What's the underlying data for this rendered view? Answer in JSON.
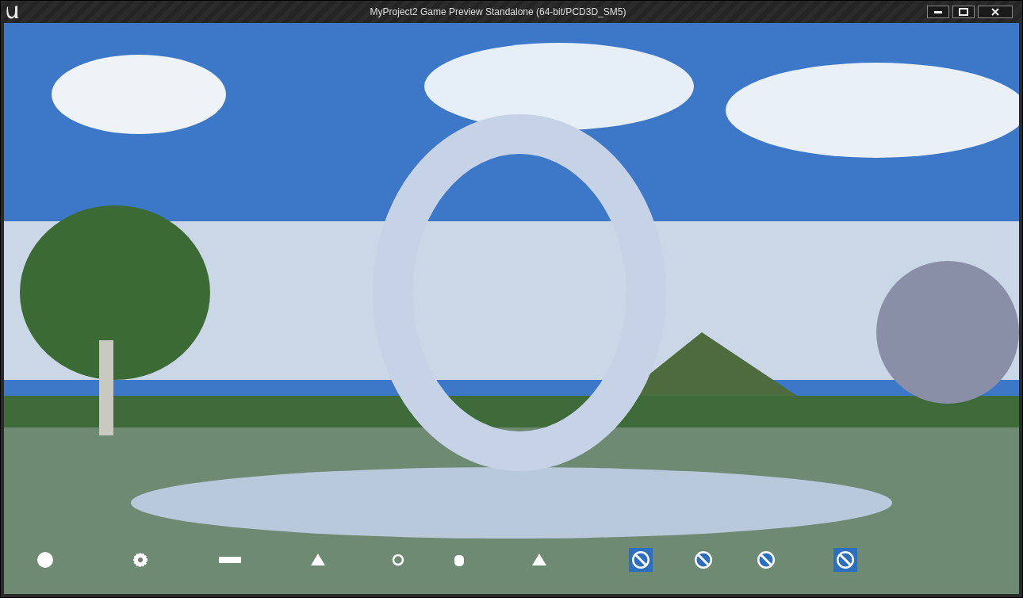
{
  "window": {
    "title": "MyProject2 Game Preview Standalone (64-bit/PCD3D_SM5)"
  },
  "hud_slots": [
    {
      "kind": "dot",
      "highlighted": false
    },
    {
      "kind": "gear",
      "highlighted": false
    },
    {
      "kind": "bar",
      "highlighted": false
    },
    {
      "kind": "triangle",
      "highlighted": false
    },
    {
      "kind": "ring",
      "highlighted": false
    },
    {
      "kind": "cylinder",
      "highlighted": false
    },
    {
      "kind": "triangle",
      "highlighted": false
    },
    {
      "kind": "blocked",
      "highlighted": true
    },
    {
      "kind": "blocked",
      "highlighted": false
    },
    {
      "kind": "blocked",
      "highlighted": false
    },
    {
      "kind": "blocked",
      "highlighted": true
    }
  ]
}
